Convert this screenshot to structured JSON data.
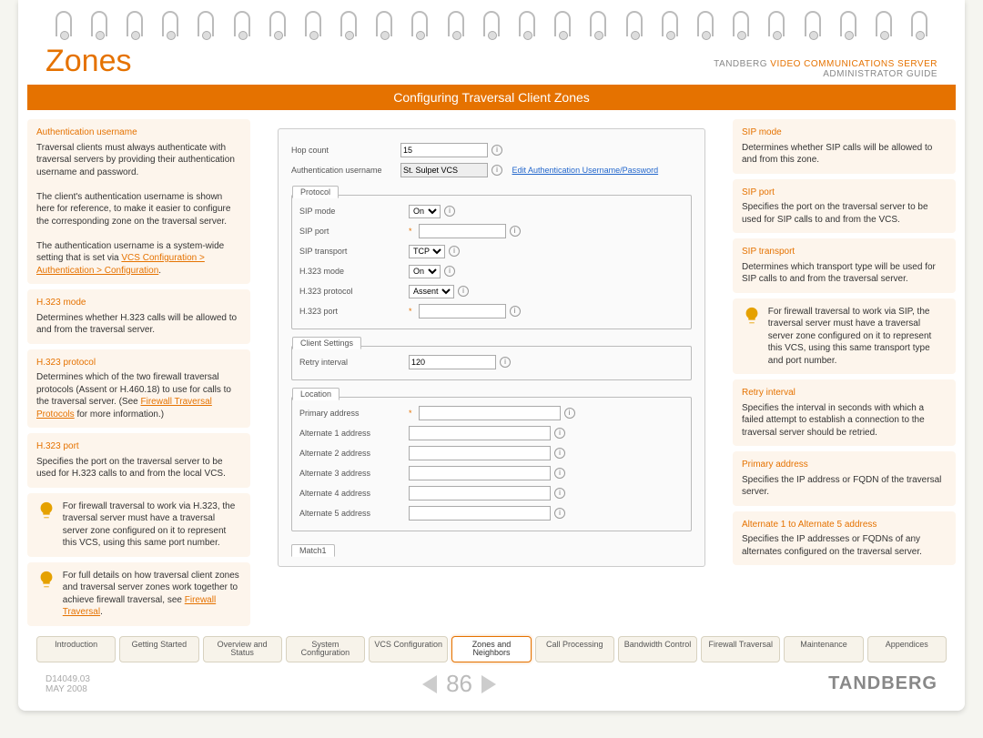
{
  "header": {
    "title": "Zones",
    "company": "TANDBERG",
    "product": "VIDEO COMMUNICATIONS SERVER",
    "subtitle": "ADMINISTRATOR GUIDE"
  },
  "banner": "Configuring Traversal Client Zones",
  "left": {
    "auth": {
      "h": "Authentication username",
      "p1": "Traversal clients must always authenticate with traversal servers by providing their authentication username and password.",
      "p2": "The client's authentication username is shown here for reference, to make it easier to configure the  corresponding zone on the traversal server.",
      "p3a": "The authentication username is a system-wide setting that is set via ",
      "p3link": "VCS Configuration > Authentication > Configuration",
      "p3b": "."
    },
    "h323mode": {
      "h": "H.323 mode",
      "p": "Determines whether H.323 calls will be allowed to and from the traversal server."
    },
    "h323protocol": {
      "h": "H.323 protocol",
      "p1": "Determines which of the two firewall traversal protocols (Assent or H.460.18) to use for calls to the traversal server. (See ",
      "link": "Firewall Traversal Protocols",
      "p2": " for more information.)"
    },
    "h323port": {
      "h": "H.323 port",
      "p": "Specifies the port on the traversal server to be used for H.323 calls to and from the local VCS."
    },
    "tip1": "For firewall traversal to work via H.323, the traversal server must have a traversal server zone configured on it to represent this VCS, using this same port number.",
    "tip2a": "For full details on how traversal client zones and traversal server zones work together to achieve firewall traversal, see ",
    "tip2link": "Firewall Traversal",
    "tip2b": "."
  },
  "right": {
    "sipmode": {
      "h": "SIP mode",
      "p": "Determines whether SIP calls will be allowed to and from this zone."
    },
    "sipport": {
      "h": "SIP port",
      "p": "Specifies the port on the traversal server to be used for SIP calls to and from the VCS."
    },
    "siptransport": {
      "h": "SIP transport",
      "p": "Determines which transport type will be used for SIP calls to and from the traversal server."
    },
    "tip": "For firewall traversal to work via SIP, the traversal server must have a traversal server zone configured on it to represent this VCS, using this same transport type and port number.",
    "retry": {
      "h": "Retry interval",
      "p": "Specifies the interval in seconds with which a failed attempt to establish a connection to the traversal server should be retried."
    },
    "primary": {
      "h": "Primary address",
      "p": "Specifies the IP address or FQDN of the traversal server."
    },
    "alternate": {
      "h": "Alternate 1 to Alternate 5 address",
      "p": "Specifies the IP addresses or FQDNs of any alternates configured on the traversal server."
    }
  },
  "form": {
    "hop_label": "Hop count",
    "hop_val": "15",
    "auth_label": "Authentication username",
    "auth_val": "St. Sulpet VCS",
    "auth_link": "Edit Authentication Username/Password",
    "protocol_tab": "Protocol",
    "sipmode": "SIP mode",
    "sipmode_val": "On",
    "sipport": "SIP port",
    "siptrans": "SIP transport",
    "siptrans_val": "TCP",
    "h323mode": "H.323 mode",
    "h323mode_val": "On",
    "h323proto": "H.323 protocol",
    "h323proto_val": "Assent",
    "h323port": "H.323 port",
    "client_tab": "Client Settings",
    "retry": "Retry interval",
    "retry_val": "120",
    "location_tab": "Location",
    "primary": "Primary address",
    "alt1": "Alternate 1 address",
    "alt2": "Alternate 2 address",
    "alt3": "Alternate 3 address",
    "alt4": "Alternate 4 address",
    "alt5": "Alternate 5 address",
    "match_tab": "Match1"
  },
  "tabs": [
    "Introduction",
    "Getting Started",
    "Overview and Status",
    "System Configuration",
    "VCS Configuration",
    "Zones and Neighbors",
    "Call Processing",
    "Bandwidth Control",
    "Firewall Traversal",
    "Maintenance",
    "Appendices"
  ],
  "active_tab_index": 5,
  "footer": {
    "doc": "D14049.03",
    "date": "MAY 2008",
    "page": "86",
    "brand": "TANDBERG"
  }
}
